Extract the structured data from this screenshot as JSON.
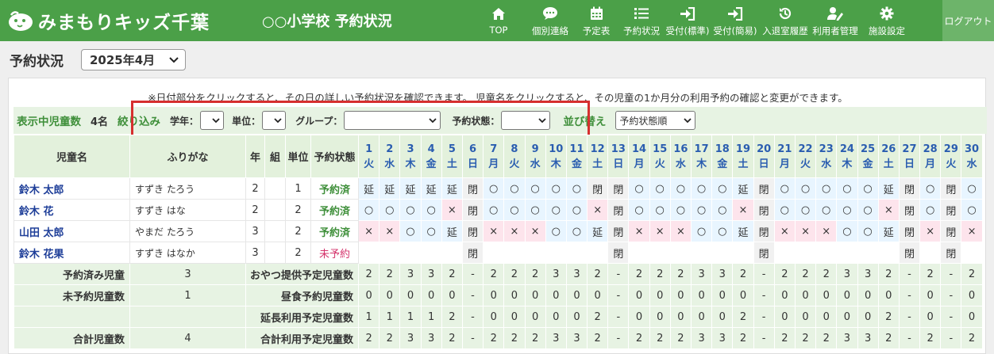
{
  "app": {
    "name": "みまもりキッズ千葉",
    "school": "○○小学校 予約状況"
  },
  "nav": [
    {
      "label": "TOP",
      "icon": "home-icon"
    },
    {
      "label": "個別連絡",
      "icon": "chat-icon"
    },
    {
      "label": "予定表",
      "icon": "calendar-icon"
    },
    {
      "label": "予約状況",
      "icon": "list-icon"
    },
    {
      "label": "受付(標準)",
      "icon": "sign-in-icon"
    },
    {
      "label": "受付(簡易)",
      "icon": "sign-in-icon"
    },
    {
      "label": "入退室履歴",
      "icon": "history-icon"
    },
    {
      "label": "利用者管理",
      "icon": "user-edit-icon"
    },
    {
      "label": "施設設定",
      "icon": "gear-icon"
    }
  ],
  "logout": "ログアウト",
  "page": {
    "title": "予約状況",
    "month": "2025年4月"
  },
  "notice": "※日付部分をクリックすると、その日の詳しい予約状況を確認できます。 児童名をクリックすると、その児童の1か月分の利用予約の確認と変更ができます。",
  "filter": {
    "shown_label": "表示中児童数",
    "shown_count": "4名",
    "narrow_label": "絞り込み",
    "grade_label": "学年：",
    "grade_value": "",
    "unit_label": "単位：",
    "unit_value": "",
    "group_label": "グループ：",
    "group_value": "",
    "status_label": "予約状態：",
    "status_value": "",
    "sort_label": "並び替え",
    "sort_value": "予約状態順"
  },
  "table": {
    "headers": {
      "name": "児童名",
      "kana": "ふりがな",
      "grade": "年",
      "class": "組",
      "unit": "単位",
      "status": "予約状態"
    },
    "days": [
      {
        "d": "1",
        "w": "火"
      },
      {
        "d": "2",
        "w": "水"
      },
      {
        "d": "3",
        "w": "木"
      },
      {
        "d": "4",
        "w": "金"
      },
      {
        "d": "5",
        "w": "土"
      },
      {
        "d": "6",
        "w": "日"
      },
      {
        "d": "7",
        "w": "月"
      },
      {
        "d": "8",
        "w": "火"
      },
      {
        "d": "9",
        "w": "水"
      },
      {
        "d": "10",
        "w": "木"
      },
      {
        "d": "11",
        "w": "金"
      },
      {
        "d": "12",
        "w": "土"
      },
      {
        "d": "13",
        "w": "日"
      },
      {
        "d": "14",
        "w": "月"
      },
      {
        "d": "15",
        "w": "火"
      },
      {
        "d": "16",
        "w": "水"
      },
      {
        "d": "17",
        "w": "木"
      },
      {
        "d": "18",
        "w": "金"
      },
      {
        "d": "19",
        "w": "土"
      },
      {
        "d": "20",
        "w": "日"
      },
      {
        "d": "21",
        "w": "月"
      },
      {
        "d": "22",
        "w": "火"
      },
      {
        "d": "23",
        "w": "水"
      },
      {
        "d": "24",
        "w": "木"
      },
      {
        "d": "25",
        "w": "金"
      },
      {
        "d": "26",
        "w": "土"
      },
      {
        "d": "27",
        "w": "日"
      },
      {
        "d": "28",
        "w": "月"
      },
      {
        "d": "29",
        "w": "火"
      },
      {
        "d": "30",
        "w": "水"
      }
    ],
    "rows": [
      {
        "name": "鈴木 太郎",
        "kana": "すずき たろう",
        "grade": "2",
        "class": "",
        "unit": "1",
        "status": "予約済",
        "reserved": true,
        "cells": [
          "延",
          "延",
          "延",
          "延",
          "延",
          "閉",
          "○",
          "○",
          "○",
          "○",
          "○",
          "閉",
          "閉",
          "○",
          "○",
          "○",
          "○",
          "○",
          "延",
          "閉",
          "○",
          "○",
          "○",
          "○",
          "○",
          "延",
          "閉",
          "○",
          "閉",
          "○"
        ]
      },
      {
        "name": "鈴木 花",
        "kana": "すずき はな",
        "grade": "2",
        "class": "",
        "unit": "2",
        "status": "予約済",
        "reserved": true,
        "cells": [
          "○",
          "○",
          "○",
          "○",
          "×",
          "閉",
          "○",
          "○",
          "○",
          "○",
          "○",
          "×",
          "閉",
          "○",
          "○",
          "○",
          "○",
          "○",
          "×",
          "閉",
          "○",
          "○",
          "○",
          "○",
          "○",
          "×",
          "閉",
          "○",
          "閉",
          "○"
        ]
      },
      {
        "name": "山田 太郎",
        "kana": "やまだ たろう",
        "grade": "3",
        "class": "",
        "unit": "2",
        "status": "予約済",
        "reserved": true,
        "cells": [
          "×",
          "×",
          "○",
          "○",
          "延",
          "閉",
          "×",
          "×",
          "×",
          "○",
          "○",
          "延",
          "閉",
          "×",
          "×",
          "×",
          "○",
          "○",
          "延",
          "閉",
          "×",
          "×",
          "×",
          "○",
          "○",
          "延",
          "閉",
          "×",
          "閉",
          "×"
        ]
      },
      {
        "name": "鈴木 花果",
        "kana": "すずき はなか",
        "grade": "3",
        "class": "",
        "unit": "2",
        "status": "未予約",
        "reserved": false,
        "cells": [
          "",
          "",
          "",
          "",
          "",
          "閉",
          "",
          "",
          "",
          "",
          "",
          "",
          "閉",
          "",
          "",
          "",
          "",
          "",
          "",
          "閉",
          "",
          "",
          "",
          "",
          "",
          "",
          "閉",
          "",
          "閉",
          ""
        ]
      }
    ],
    "summary": [
      {
        "left_label": "予約済み児童",
        "left_value": "3",
        "label": "おやつ提供予定児童数",
        "values": [
          "2",
          "2",
          "3",
          "3",
          "2",
          "-",
          "2",
          "2",
          "2",
          "3",
          "3",
          "2",
          "-",
          "2",
          "2",
          "2",
          "3",
          "3",
          "2",
          "-",
          "2",
          "2",
          "2",
          "3",
          "3",
          "2",
          "-",
          "2",
          "-",
          "2"
        ]
      },
      {
        "left_label": "未予約児童数",
        "left_value": "1",
        "label": "昼食予約児童数",
        "values": [
          "0",
          "0",
          "0",
          "0",
          "0",
          "-",
          "0",
          "0",
          "0",
          "0",
          "0",
          "0",
          "-",
          "0",
          "0",
          "0",
          "0",
          "0",
          "0",
          "-",
          "0",
          "0",
          "0",
          "0",
          "0",
          "0",
          "-",
          "0",
          "-",
          "0"
        ]
      },
      {
        "left_label": "",
        "left_value": "",
        "label": "延長利用予定児童数",
        "values": [
          "1",
          "1",
          "1",
          "1",
          "2",
          "-",
          "0",
          "0",
          "0",
          "0",
          "0",
          "2",
          "-",
          "0",
          "0",
          "0",
          "0",
          "0",
          "2",
          "-",
          "0",
          "0",
          "0",
          "0",
          "0",
          "2",
          "-",
          "0",
          "-",
          "0"
        ]
      },
      {
        "left_label": "合計児童数",
        "left_value": "4",
        "label": "合計利用予定児童数",
        "values": [
          "2",
          "2",
          "3",
          "3",
          "2",
          "-",
          "2",
          "2",
          "2",
          "3",
          "3",
          "2",
          "-",
          "2",
          "2",
          "2",
          "3",
          "3",
          "2",
          "-",
          "2",
          "2",
          "2",
          "3",
          "3",
          "2",
          "-",
          "2",
          "-",
          "2"
        ]
      }
    ]
  },
  "colors": {
    "header_green": "#4ba048",
    "filter_green": "#e7f3e3",
    "closed": "#f1f1f1",
    "absent": "#fde4ec",
    "reserved": "#e8f5ff",
    "highlight_red": "#d62f2f"
  }
}
